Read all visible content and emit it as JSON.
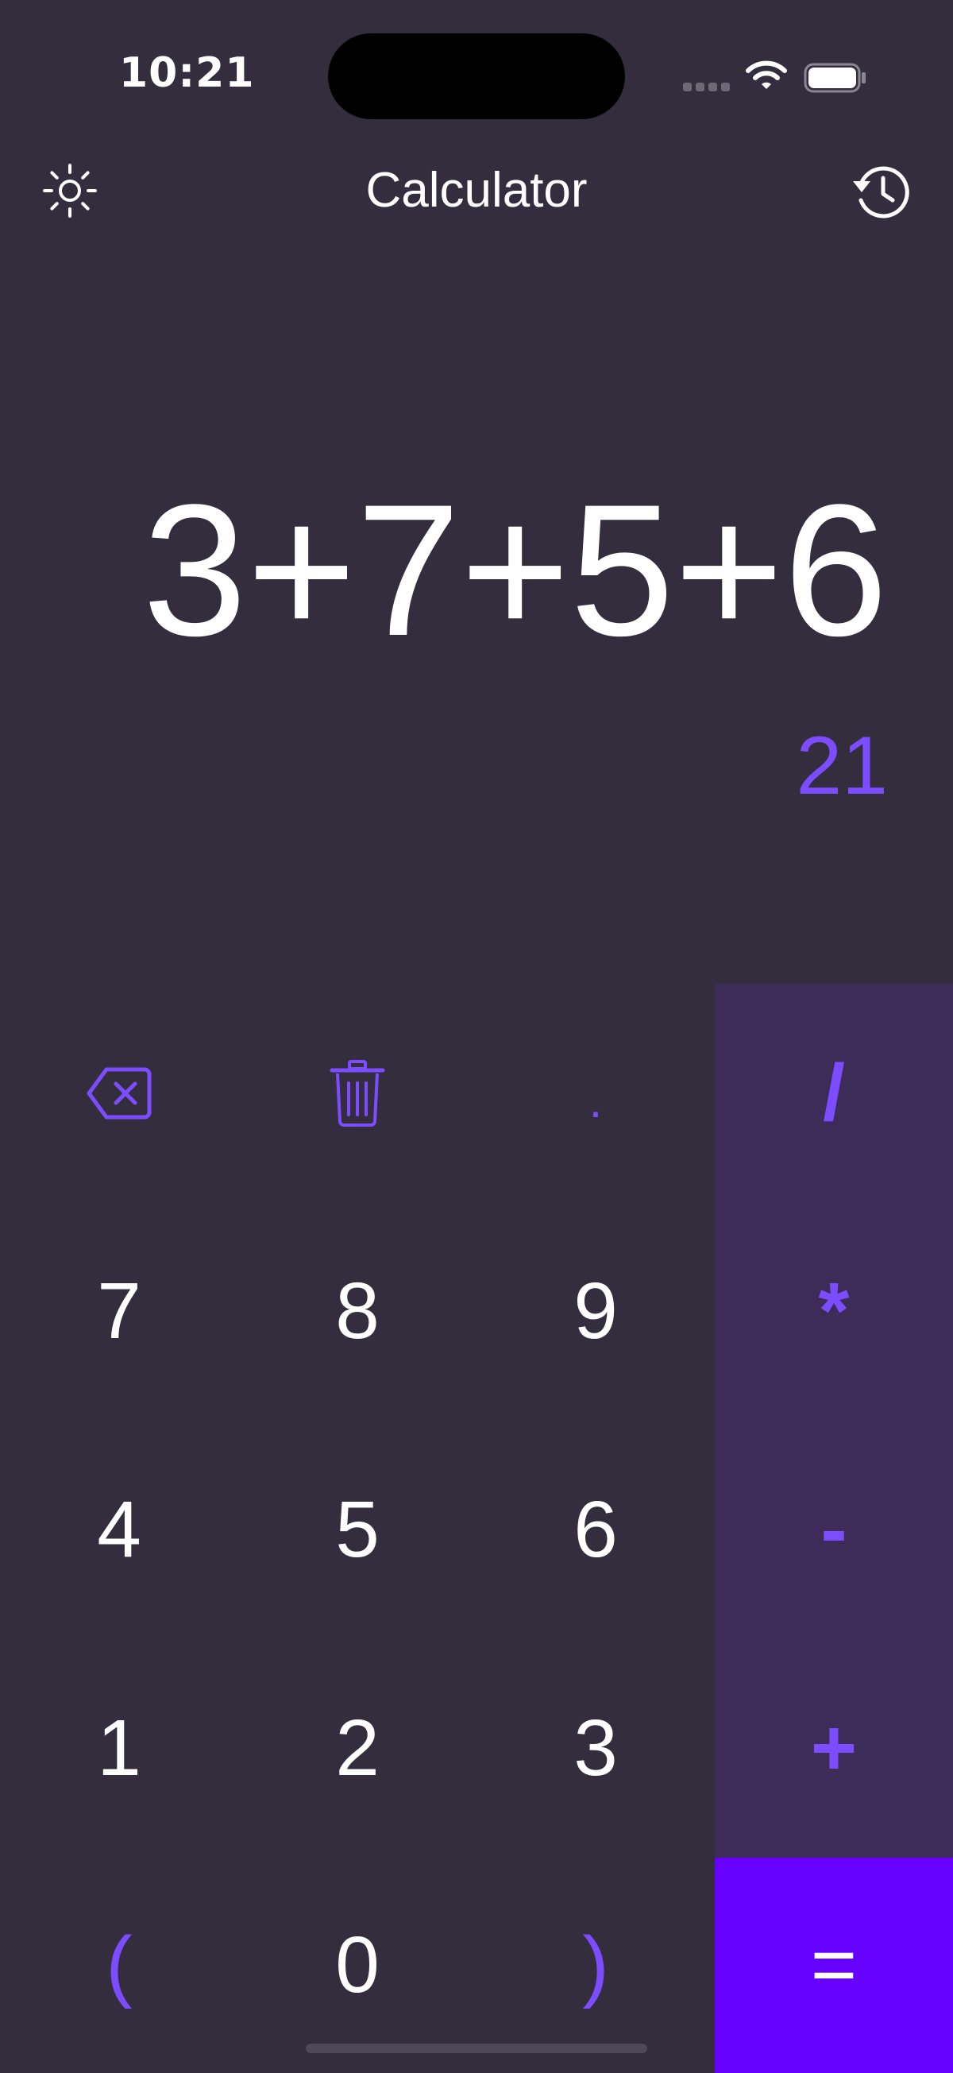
{
  "status_bar": {
    "time": "10:21"
  },
  "header": {
    "title": "Calculator",
    "theme_icon": "sun-icon",
    "history_icon": "history-icon"
  },
  "display": {
    "expression": "3+7+5+6",
    "result": "21"
  },
  "keypad": {
    "backspace_icon": "backspace-icon",
    "clear_icon": "trash-icon",
    "dot": ".",
    "divide": "/",
    "multiply": "*",
    "minus": "-",
    "plus": "+",
    "equals": "=",
    "seven": "7",
    "eight": "8",
    "nine": "9",
    "four": "4",
    "five": "5",
    "six": "6",
    "one": "1",
    "two": "2",
    "three": "3",
    "open_paren": "(",
    "zero": "0",
    "close_paren": ")"
  },
  "colors": {
    "background": "#332d3e",
    "accent": "#7c4dff",
    "operator_column": "#3d2b58",
    "equals_key": "#6600ff",
    "text": "#ffffff"
  }
}
